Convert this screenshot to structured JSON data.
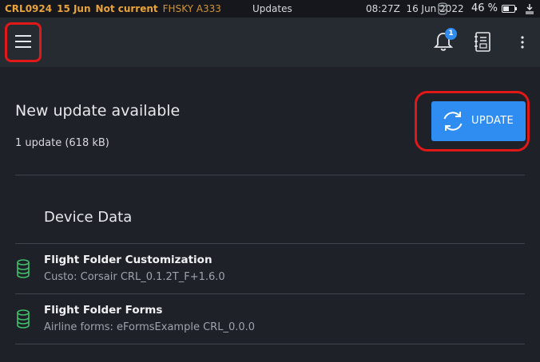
{
  "status_bar": {
    "flight": "CRL0924",
    "date": "15 Jun",
    "state": "Not current",
    "aircraft": "FHSKY A333",
    "screen_title": "Updates",
    "time": "08:27Z",
    "current_date": "16 Jun 2022",
    "battery": "46 %"
  },
  "app_bar": {
    "notifications_count": "1"
  },
  "update": {
    "title": "New update available",
    "size": "1 update (618 kB)",
    "button_label": "UPDATE"
  },
  "device_data": {
    "heading": "Device Data",
    "items": [
      {
        "title": "Flight Folder Customization",
        "subtitle": "Custo: Corsair CRL_0.1.2T_F+1.6.0"
      },
      {
        "title": "Flight Folder Forms",
        "subtitle": "Airline forms: eFormsExample CRL_0.0.0"
      }
    ]
  },
  "colors": {
    "background": "#1e2128",
    "app_bar": "#262a31",
    "accent": "#2f8cf0",
    "status_warning": "#e8a33a",
    "db_icon": "#3fbf6a",
    "highlight": "#e01818"
  },
  "icons": [
    "menu-icon",
    "bell-icon",
    "ebook-icon",
    "more-vert-icon",
    "sync-icon",
    "database-icon",
    "battery-icon",
    "storage-icon",
    "download-icon"
  ]
}
